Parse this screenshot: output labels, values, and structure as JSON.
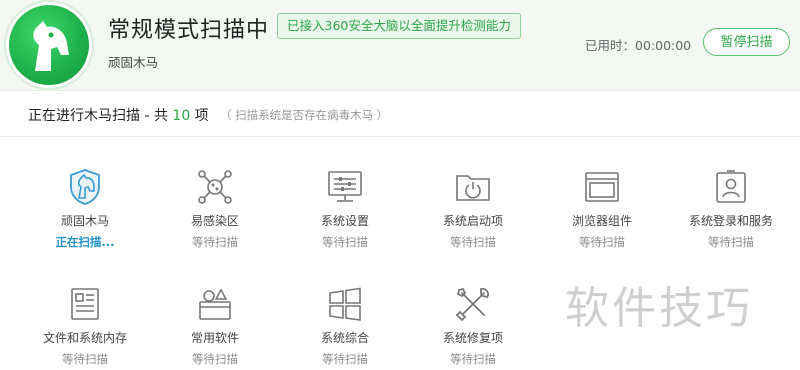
{
  "header": {
    "title": "常规模式扫描中",
    "badge": "已接入360安全大脑以全面提升检测能力",
    "subtitle": "顽固木马",
    "elapsed": "已用时：00:00:00",
    "pause_label": "暂停扫描"
  },
  "section": {
    "title_prefix": "正在进行木马扫描 - 共 ",
    "count": "10",
    "title_suffix": " 项",
    "note": "（ 扫描系统是否存在病毒木马 ）"
  },
  "items": [
    {
      "name": "顽固木马",
      "status": "正在扫描...",
      "icon": "shield-horse-icon"
    },
    {
      "name": "易感染区",
      "status": "等待扫描",
      "icon": "network-nodes-icon"
    },
    {
      "name": "系统设置",
      "status": "等待扫描",
      "icon": "monitor-settings-icon"
    },
    {
      "name": "系统启动项",
      "status": "等待扫描",
      "icon": "folder-power-icon"
    },
    {
      "name": "浏览器组件",
      "status": "等待扫描",
      "icon": "browser-window-icon"
    },
    {
      "name": "系统登录和服务",
      "status": "等待扫描",
      "icon": "id-card-icon"
    },
    {
      "name": "文件和系统内存",
      "status": "等待扫描",
      "icon": "document-icon"
    },
    {
      "name": "常用软件",
      "status": "等待扫描",
      "icon": "software-box-icon"
    },
    {
      "name": "系统综合",
      "status": "等待扫描",
      "icon": "windows-logo-icon"
    },
    {
      "name": "系统修复项",
      "status": "等待扫描",
      "icon": "wrench-screwdriver-icon"
    }
  ],
  "watermark": "软件技巧",
  "colors": {
    "accent": "#2fa64a",
    "active_status": "#1f93c9",
    "header_bg": "#f3f8f3"
  }
}
